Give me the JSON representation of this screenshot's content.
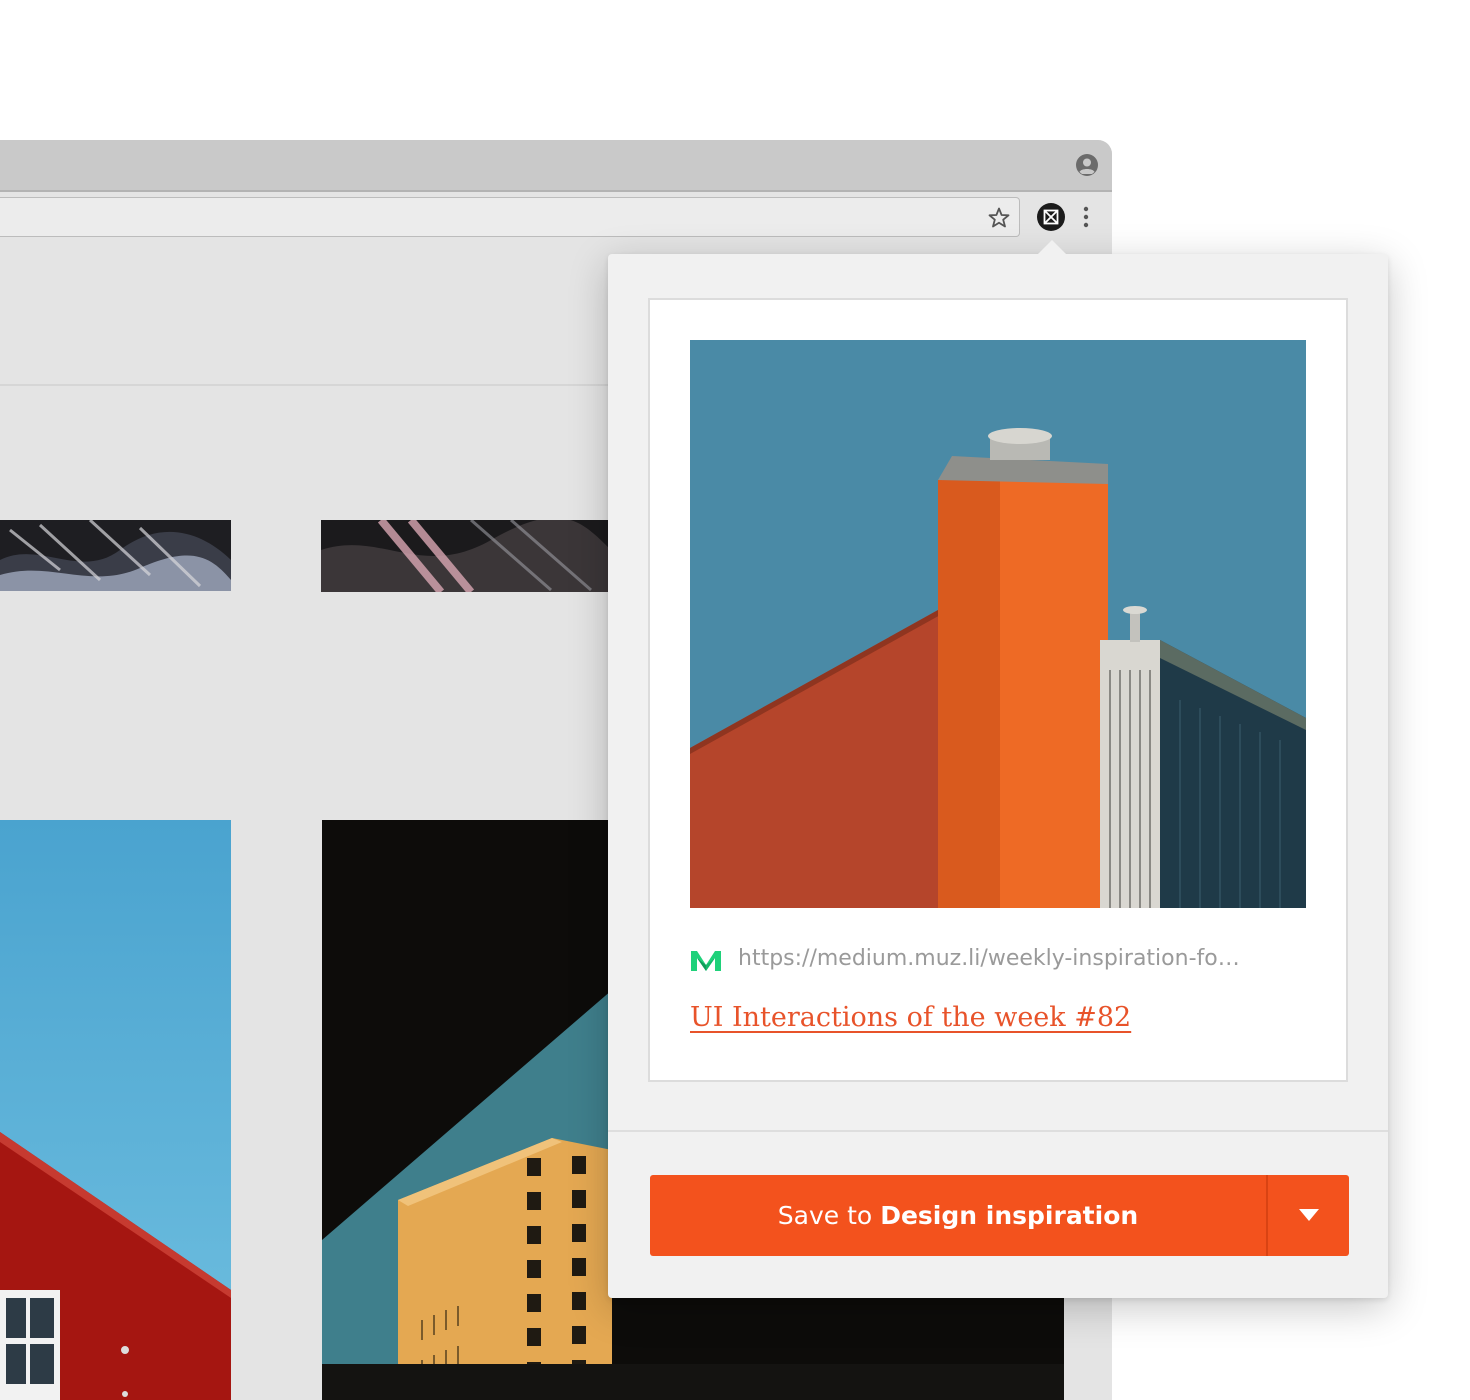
{
  "browser": {
    "icons": {
      "profile": "account-circle-icon",
      "star": "star-outline-icon",
      "extension": "muzli-extension-icon",
      "menu": "vertical-dots-icon"
    }
  },
  "popup": {
    "source_url": "https://medium.muz.li/weekly-inspiration-fo…",
    "source_icon": "medium-logo-icon",
    "article_title": "UI Interactions of the week #82",
    "save_button": {
      "prefix": "Save to",
      "target": "Design inspiration"
    },
    "dropdown_icon": "chevron-down-icon"
  },
  "colors": {
    "accent": "#f3521d",
    "title_link": "#e8532a",
    "medium_green": "#1fd17a"
  }
}
